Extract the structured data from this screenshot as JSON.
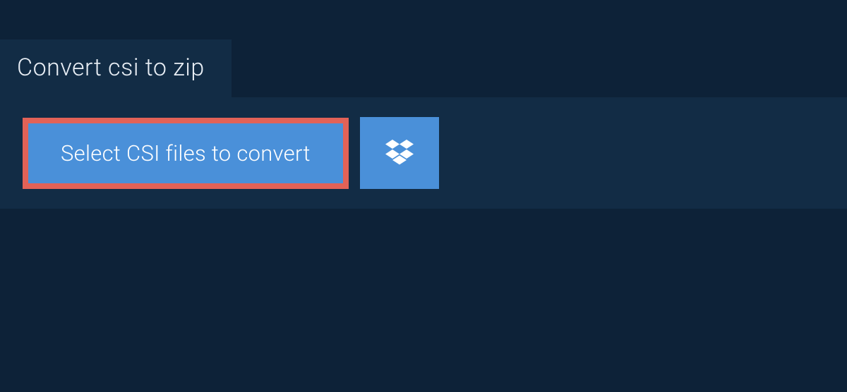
{
  "tab": {
    "label": "Convert csi to zip"
  },
  "actions": {
    "select_label": "Select CSI files to convert"
  }
}
